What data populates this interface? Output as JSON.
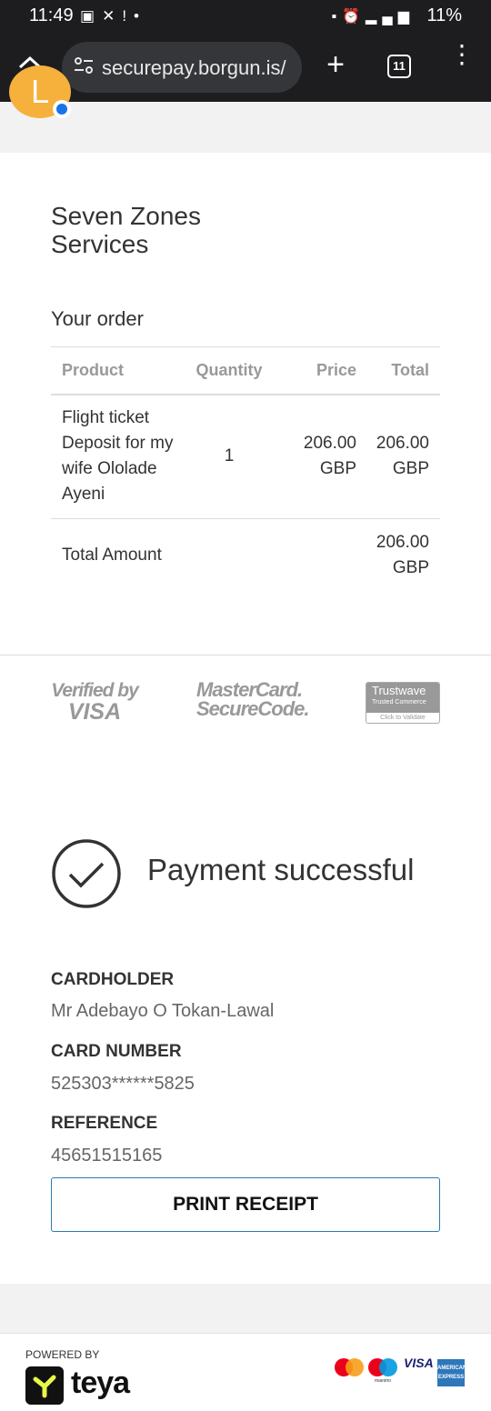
{
  "status_bar": {
    "time": "11:49",
    "left_icons": [
      "image-icon",
      "app-icon",
      "alert-icon",
      "dot-icon"
    ],
    "right_icons": [
      "save-icon",
      "alarm-icon",
      "volte-icon",
      "5g-icon",
      "signal-icon"
    ],
    "battery": "11%"
  },
  "browser": {
    "url": "securepay.borgun.is/",
    "tab_count": "11",
    "avatar_letter": "L"
  },
  "merchant_name": "Seven Zones Services",
  "order": {
    "title": "Your order",
    "headers": [
      "Product",
      "Quantity",
      "Price",
      "Total"
    ],
    "item": {
      "product": "Flight ticket Deposit for my wife Ololade Ayeni",
      "quantity": "1",
      "price": "206.00 GBP",
      "total": "206.00 GBP"
    },
    "total_label": "Total Amount",
    "total_value": "206.00 GBP"
  },
  "badges": {
    "vbv_line1": "Verified by",
    "vbv_line2": "VISA",
    "mc_line1": "MasterCard.",
    "mc_line2": "SecureCode.",
    "trustwave_title": "Trustwave",
    "trustwave_sub": "Trusted Commerce",
    "trustwave_link": "Click to Validate"
  },
  "result": {
    "message": "Payment successful",
    "cardholder_label": "CARDHOLDER",
    "cardholder_value": "Mr Adebayo O Tokan-Lawal",
    "card_number_label": "CARD NUMBER",
    "card_number_value": "525303******5825",
    "reference_label": "REFERENCE",
    "reference_value": "45651515165",
    "print_button": "PRINT RECEIPT"
  },
  "footer": {
    "powered_by": "POWERED BY",
    "brand": "teya",
    "visa": "VISA",
    "maestro": "maestro",
    "amex": "AMERICAN EXPRESS"
  },
  "colors": {
    "browser_chrome": "#1d1d1f",
    "avatar": "#f6b03c",
    "button_border": "#2a7ab0",
    "muted": "#999999"
  }
}
